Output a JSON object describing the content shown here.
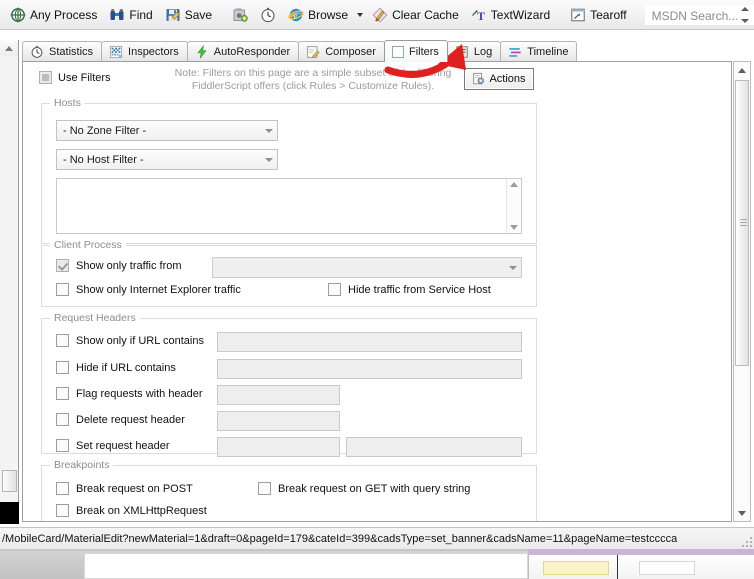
{
  "toolbar": {
    "items": [
      {
        "label": "Any Process",
        "icon": "target-icon"
      },
      {
        "label": "Find",
        "icon": "binoculars-icon"
      },
      {
        "label": "Save",
        "icon": "save-disk-icon"
      },
      {
        "label": "",
        "icon": "camera-icon"
      },
      {
        "label": "",
        "icon": "clock-icon"
      },
      {
        "label": "Browse",
        "icon": "internet-explorer-icon"
      },
      {
        "label": "Clear Cache",
        "icon": "broom-icon"
      },
      {
        "label": "TextWizard",
        "icon": "text-wizard-icon"
      },
      {
        "label": "Tearoff",
        "icon": "tearoff-icon"
      }
    ],
    "search_placeholder": "MSDN Search..."
  },
  "tabs": [
    {
      "label": "Statistics",
      "icon": "clock-icon",
      "active": false
    },
    {
      "label": "Inspectors",
      "icon": "inspectors-icon",
      "active": false
    },
    {
      "label": "AutoResponder",
      "icon": "lightning-icon",
      "active": false
    },
    {
      "label": "Composer",
      "icon": "compose-icon",
      "active": false
    },
    {
      "label": "Filters",
      "icon": "filter-checkbox-icon",
      "active": true
    },
    {
      "label": "Log",
      "icon": "log-icon",
      "active": false
    },
    {
      "label": "Timeline",
      "icon": "timeline-icon",
      "active": false
    }
  ],
  "filters": {
    "use_filters_label": "Use Filters",
    "use_filters_checked": false,
    "note_line1": "Note: Filters on this page are a simple subset of the filtering",
    "note_line2": "FiddlerScript offers (click Rules > Customize Rules).",
    "actions_label": "Actions",
    "actions_icon": "actions-gear-icon",
    "hosts": {
      "title": "Hosts",
      "zone_filter_value": "- No Zone Filter -",
      "host_filter_value": "- No Host Filter -",
      "host_list_value": ""
    },
    "client_process": {
      "title": "Client Process",
      "show_only_traffic_from_label": "Show only traffic from",
      "show_only_traffic_from_checked": true,
      "process_combo_value": "",
      "show_only_ie_label": "Show only Internet Explorer traffic",
      "show_only_ie_checked": false,
      "hide_service_host_label": "Hide traffic from Service Host",
      "hide_service_host_checked": false
    },
    "request_headers": {
      "title": "Request Headers",
      "rows": [
        {
          "label": "Show only if URL contains",
          "checked": false,
          "value": ""
        },
        {
          "label": "Hide if URL contains",
          "checked": false,
          "value": ""
        },
        {
          "label": "Flag requests with header",
          "checked": false,
          "value": ""
        },
        {
          "label": "Delete request header",
          "checked": false,
          "value": ""
        },
        {
          "label": "Set request header",
          "checked": false,
          "value": "",
          "value2": ""
        }
      ]
    },
    "breakpoints": {
      "title": "Breakpoints",
      "break_post_label": "Break request on POST",
      "break_post_checked": false,
      "break_get_query_label": "Break request on GET with query string",
      "break_get_query_checked": false,
      "break_xhr_label": "Break on XMLHttpRequest",
      "break_xhr_checked": false
    }
  },
  "statusbar": {
    "url": "/MobileCard/MaterialEdit?newMaterial=1&draft=0&pageId=179&cateId=399&cadsType=set_banner&cadsName=11&pageName=testcccca"
  },
  "annotation": {
    "type": "red-arrow",
    "color": "#e02020",
    "points_to": "Filters tab"
  }
}
